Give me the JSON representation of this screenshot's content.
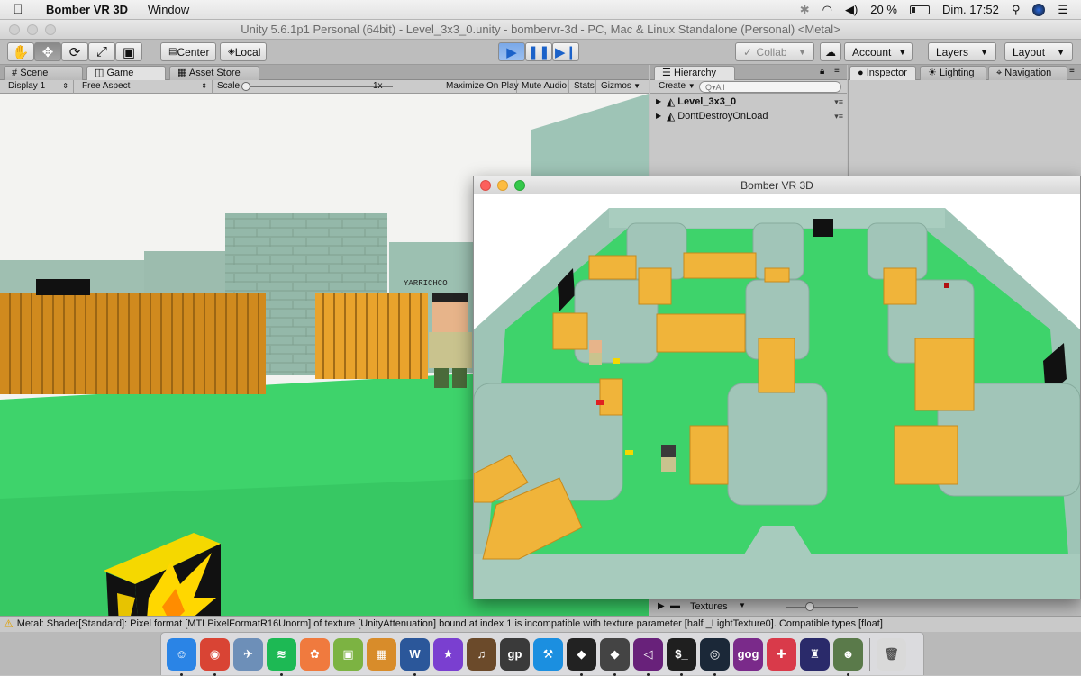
{
  "menubar": {
    "app_name": "Bomber VR 3D",
    "menu_window": "Window",
    "battery": "20 %",
    "clock": "Dim. 17:52"
  },
  "unity": {
    "title": "Unity 5.6.1p1 Personal (64bit) - Level_3x3_0.unity - bombervr-3d - PC, Mac & Linux Standalone (Personal) <Metal>"
  },
  "toolbar": {
    "pivot_label": "Center",
    "space_label": "Local",
    "collab_label": "Collab",
    "account_label": "Account",
    "layers_label": "Layers",
    "layout_label": "Layout"
  },
  "tabs": {
    "scene": "Scene",
    "game": "Game",
    "asset_store": "Asset Store",
    "hierarchy": "Hierarchy",
    "inspector": "Inspector",
    "lighting": "Lighting",
    "navigation": "Navigation"
  },
  "game_bar": {
    "display": "Display 1",
    "aspect": "Free Aspect",
    "scale_label": "Scale",
    "scale_value": "1x",
    "maximize": "Maximize On Play",
    "mute": "Mute Audio",
    "stats": "Stats",
    "gizmos": "Gizmos"
  },
  "hierarchy": {
    "create_label": "Create",
    "search_placeholder": "Q▾All",
    "items": [
      {
        "label": "Level_3x3_0"
      },
      {
        "label": "DontDestroyOnLoad"
      }
    ]
  },
  "game_window": {
    "title": "Bomber VR 3D"
  },
  "project": {
    "folder_label": "Textures"
  },
  "status": {
    "message": "Metal: Shader[Standard]: Pixel format [MTLPixelFormatR16Unorm] of texture [UnityAttenuation] bound at index 1 is incompatible with texture parameter [half _LightTexture0]. Compatible types [float]"
  },
  "player_name": "YARRICHCO",
  "colors": {
    "floor": "#3ed36b",
    "stone": "#9cc2b4",
    "crate": "#f0b43a",
    "accent_blue": "#1b62c9"
  },
  "dock": {
    "icons": [
      {
        "name": "finder-icon",
        "glyph": "☺",
        "color": "#2a84e6",
        "running": true
      },
      {
        "name": "chrome-icon",
        "glyph": "◉",
        "color": "#d94434",
        "running": true
      },
      {
        "name": "preview-icon",
        "glyph": "✈",
        "color": "#6d8fb8",
        "running": false
      },
      {
        "name": "spotify-icon",
        "glyph": "≋",
        "color": "#1db954",
        "running": true
      },
      {
        "name": "photos-icon",
        "glyph": "✿",
        "color": "#f07a3e",
        "running": false
      },
      {
        "name": "android-icon",
        "glyph": "▣",
        "color": "#7cb342",
        "running": false
      },
      {
        "name": "pixelmator-icon",
        "glyph": "▦",
        "color": "#d88c2a",
        "running": false
      },
      {
        "name": "word-icon",
        "glyph": "W",
        "color": "#2b579a",
        "running": true
      },
      {
        "name": "imovie-icon",
        "glyph": "★",
        "color": "#7a3fd0",
        "running": false
      },
      {
        "name": "garageband-icon",
        "glyph": "♫",
        "color": "#6b4a2a",
        "running": false
      },
      {
        "name": "guitar-pro-icon",
        "glyph": "gp",
        "color": "#3a3a3a",
        "running": false
      },
      {
        "name": "xcode-icon",
        "glyph": "⚒",
        "color": "#1b8fe0",
        "running": false
      },
      {
        "name": "unity-icon",
        "glyph": "◆",
        "color": "#222222",
        "running": true
      },
      {
        "name": "unity-hub-icon",
        "glyph": "◆",
        "color": "#444444",
        "running": true
      },
      {
        "name": "visual-studio-icon",
        "glyph": "◁",
        "color": "#68217a",
        "running": true
      },
      {
        "name": "terminal-icon",
        "glyph": "$_",
        "color": "#1f1f1f",
        "running": true
      },
      {
        "name": "steam-icon",
        "glyph": "◎",
        "color": "#1b2838",
        "running": true
      },
      {
        "name": "gog-icon",
        "glyph": "gog",
        "color": "#7a2a8a",
        "running": false
      },
      {
        "name": "gamepad-icon",
        "glyph": "✚",
        "color": "#d93a4a",
        "running": false
      },
      {
        "name": "joystick-icon",
        "glyph": "♜",
        "color": "#2a2a6a",
        "running": false
      },
      {
        "name": "bomber-game-icon",
        "glyph": "☻",
        "color": "#5a7a4a",
        "running": true
      },
      {
        "name": "trash-icon",
        "glyph": "🗑",
        "color": "#d9d9d9",
        "running": false
      }
    ]
  }
}
